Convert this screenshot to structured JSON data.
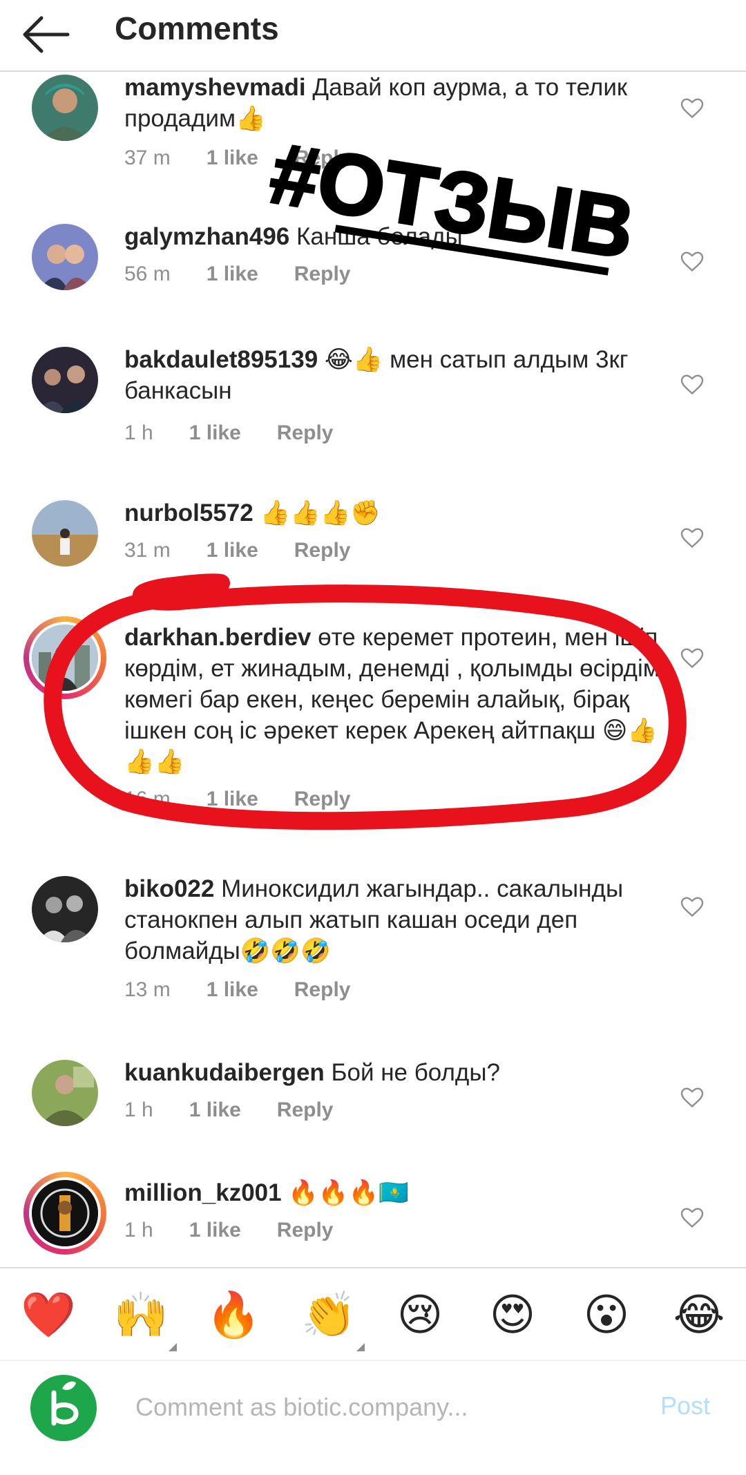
{
  "header": {
    "title": "Comments"
  },
  "overlay": {
    "tag_text": "#ОТЗЫВ"
  },
  "comments": [
    {
      "username": "mamyshevmadi",
      "text": " Давай коп аурма, а то телик продадим👍",
      "time": "37 m",
      "likes": "1 like",
      "reply": "Reply"
    },
    {
      "username": "galymzhan496",
      "text": " Канша болады",
      "time": "56 m",
      "likes": "1 like",
      "reply": "Reply"
    },
    {
      "username": "bakdaulet895139",
      "text": " 😂👍 мен сатып алдым 3кг банкасын",
      "time": "1 h",
      "likes": "1 like",
      "reply": "Reply"
    },
    {
      "username": "nurbol5572",
      "text": " 👍👍👍✊",
      "time": "31 m",
      "likes": "1 like",
      "reply": "Reply"
    },
    {
      "username": "darkhan.berdiev",
      "text": " өте керемет протеин, мен ішіп көрдім, ет жинадым, денемді , қолымды өсірдім, көмегі бар екен, кеңес беремін алайық, бірақ ішкен соң іс әрекет керек Арекең айтпақш 😄👍👍👍",
      "time": "16 m",
      "likes": "1 like",
      "reply": "Reply"
    },
    {
      "username": "biko022",
      "text": " Миноксидил жагындар.. сакалынды станокпен алып жатып кашан оседи деп болмайды🤣🤣🤣",
      "time": "13 m",
      "likes": "1 like",
      "reply": "Reply"
    },
    {
      "username": "kuankudaibergen",
      "text": " Бой не болды?",
      "time": "1 h",
      "likes": "1 like",
      "reply": "Reply"
    },
    {
      "username": "million_kz001",
      "text": " 🔥🔥🔥🇰🇿",
      "time": "1 h",
      "likes": "1 like",
      "reply": "Reply"
    }
  ],
  "emoji_bar": [
    "❤️",
    "🙌",
    "🔥",
    "👏",
    "😢",
    "😍",
    "😮",
    "😂"
  ],
  "input": {
    "placeholder": "Comment as biotic.company...",
    "post_label": "Post"
  },
  "colors": {
    "highlight": "#e8121c",
    "accent": "#0095f6",
    "post_disabled": "#b2dffc",
    "muted": "#8e8e8e"
  }
}
